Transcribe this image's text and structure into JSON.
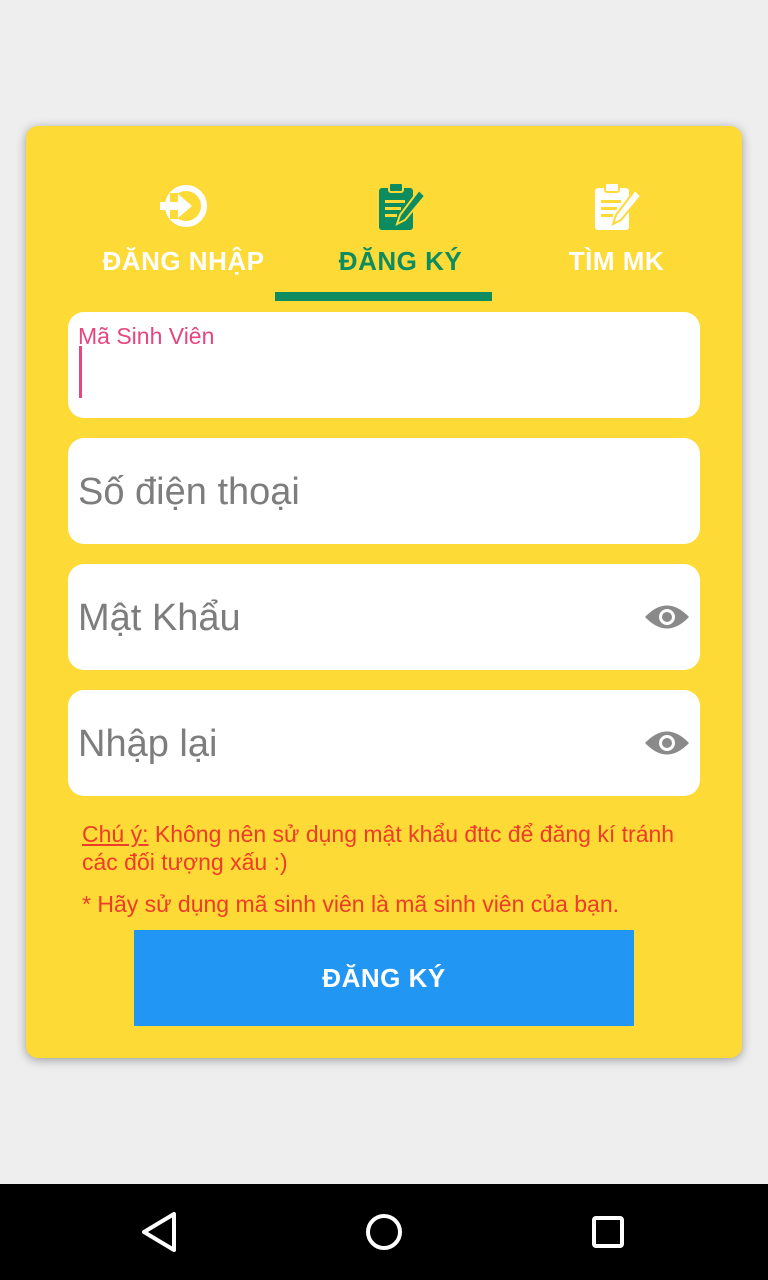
{
  "tabs": [
    {
      "label": "ĐĂNG NHẬP",
      "icon": "login-icon",
      "active": false
    },
    {
      "label": "ĐĂNG KÝ",
      "icon": "clipboard-edit-icon",
      "active": true
    },
    {
      "label": "TÌM MK",
      "icon": "clipboard-edit-icon",
      "active": false
    }
  ],
  "form": {
    "student_id": {
      "label": "Mã Sinh Viên",
      "value": ""
    },
    "phone": {
      "placeholder": "Số điện thoại",
      "value": ""
    },
    "password": {
      "placeholder": "Mật Khẩu",
      "value": "",
      "icon": "eye-icon"
    },
    "confirm_password": {
      "placeholder": "Nhập lại",
      "value": "",
      "icon": "eye-icon"
    }
  },
  "note": {
    "prefix": "Chú ý:",
    "text": " Không nên sử dụng mật khẩu đttc để đăng kí tránh các đối tượng xấu :)"
  },
  "hint": "* Hãy sử dụng mã sinh viên là mã sinh viên của bạn.",
  "submit_label": "ĐĂNG KÝ",
  "colors": {
    "card_bg": "#fdda35",
    "accent_green": "#0c8c5f",
    "accent_pink": "#e6457e",
    "warning_red": "#ef3b2a",
    "button_blue": "#2196f3"
  },
  "navbar": {
    "icons": [
      "back-icon",
      "home-icon",
      "recents-icon"
    ]
  }
}
